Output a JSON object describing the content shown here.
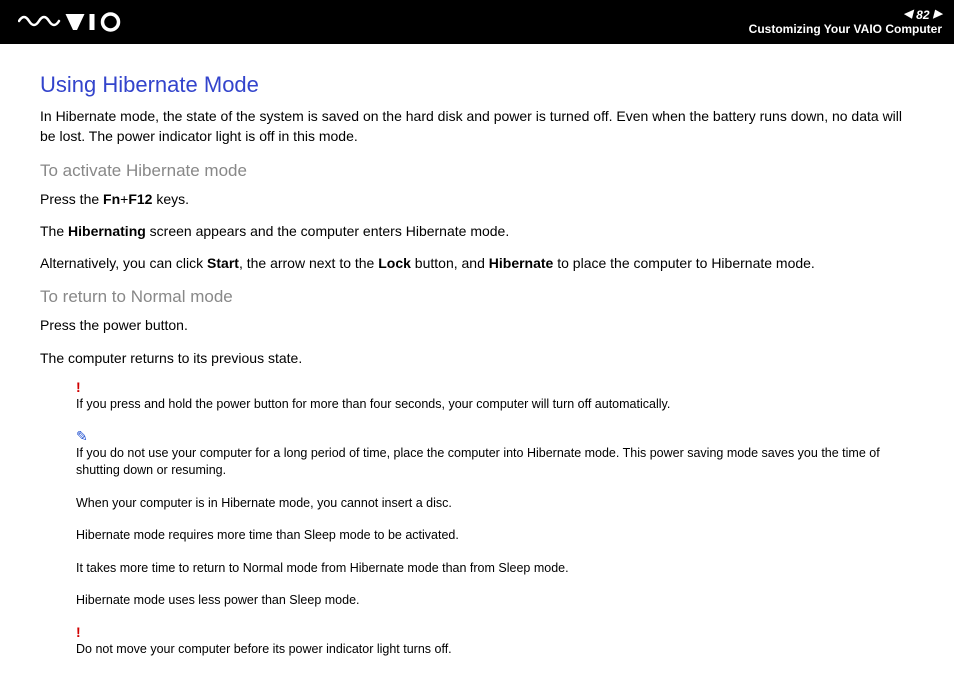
{
  "header": {
    "page_number": "82",
    "section_title": "Customizing Your VAIO Computer"
  },
  "content": {
    "main_heading": "Using Hibernate Mode",
    "intro": "In Hibernate mode, the state of the system is saved on the hard disk and power is turned off. Even when the battery runs down, no data will be lost. The power indicator light is off in this mode.",
    "activate_heading": "To activate Hibernate mode",
    "activate_p1_pre": "Press the ",
    "activate_p1_bold1": "Fn",
    "activate_p1_plus": "+",
    "activate_p1_bold2": "F12",
    "activate_p1_post": " keys.",
    "activate_p2_pre": "The ",
    "activate_p2_bold": "Hibernating",
    "activate_p2_post": " screen appears and the computer enters Hibernate mode.",
    "activate_p3_1": "Alternatively, you can click ",
    "activate_p3_bold1": "Start",
    "activate_p3_2": ", the arrow next to the ",
    "activate_p3_bold2": "Lock",
    "activate_p3_3": " button, and ",
    "activate_p3_bold3": "Hibernate",
    "activate_p3_4": " to place the computer to Hibernate mode.",
    "return_heading": "To return to Normal mode",
    "return_p1": "Press the power button.",
    "return_p2": "The computer returns to its previous state.",
    "warn1": "If you press and hold the power button for more than four seconds, your computer will turn off automatically.",
    "tip1": "If you do not use your computer for a long period of time, place the computer into Hibernate mode. This power saving mode saves you the time of shutting down or resuming.",
    "tip2": "When your computer is in Hibernate mode, you cannot insert a disc.",
    "tip3": "Hibernate mode requires more time than Sleep mode to be activated.",
    "tip4": "It takes more time to return to Normal mode from Hibernate mode than from Sleep mode.",
    "tip5": "Hibernate mode uses less power than Sleep mode.",
    "warn2": "Do not move your computer before its power indicator light turns off."
  }
}
